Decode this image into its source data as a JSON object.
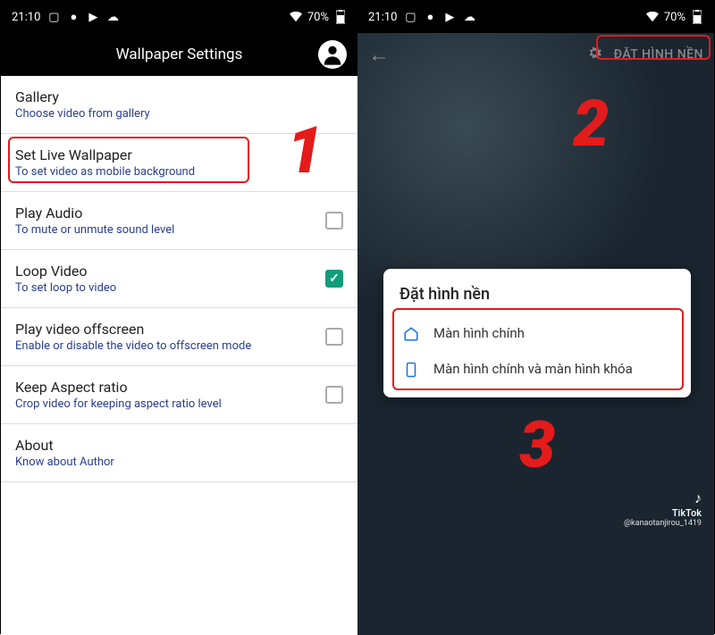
{
  "statusbar": {
    "time": "21:10",
    "battery_pct": "70%"
  },
  "left": {
    "header_title": "Wallpaper Settings",
    "items": [
      {
        "title": "Gallery",
        "sub": "Choose video from gallery",
        "checkbox": null
      },
      {
        "title": "Set Live Wallpaper",
        "sub": "To set video as mobile background",
        "checkbox": null
      },
      {
        "title": "Play Audio",
        "sub": "To mute or unmute sound level",
        "checkbox": false
      },
      {
        "title": "Loop Video",
        "sub": "To set loop to video",
        "checkbox": true
      },
      {
        "title": "Play video offscreen",
        "sub": "Enable or disable the video to offscreen mode",
        "checkbox": false
      },
      {
        "title": "Keep Aspect ratio",
        "sub": "Crop video for keeping aspect ratio level",
        "checkbox": false
      },
      {
        "title": "About",
        "sub": "Know about Author",
        "checkbox": null
      }
    ]
  },
  "right": {
    "apply_label": "ĐẶT HÌNH NỀN",
    "dialog_title": "Đặt hình nền",
    "option1": "Màn hình chính",
    "option2": "Màn hình chính và màn hình khóa",
    "tiktok_label": "TikTok",
    "tiktok_user": "@kanaotanjirou_1419"
  },
  "annotations": {
    "num1": "1",
    "num2": "2",
    "num3": "3"
  }
}
